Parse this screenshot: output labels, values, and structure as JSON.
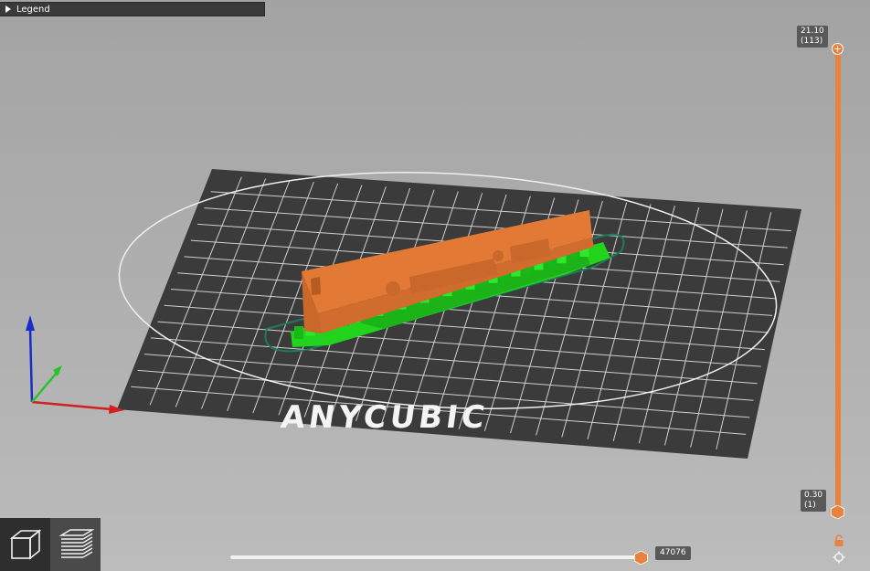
{
  "legend": {
    "label": "Legend"
  },
  "bed": {
    "brand_text": "ANYCUBIC"
  },
  "layer_slider": {
    "top_value": "21.10",
    "top_layer": "(113)",
    "bottom_value": "0.30",
    "bottom_layer": "(1)"
  },
  "move_slider": {
    "value": "47076"
  },
  "colors": {
    "accent": "#e8823f",
    "model": "#e8823f",
    "support": "#22d31e",
    "bed": "#3b3b3b",
    "skirt": "#1d7a5c"
  },
  "icons": [
    "legend-expand-icon",
    "3d-view-icon",
    "preview-layers-icon",
    "lock-icon",
    "settings-cog-icon",
    "plus-icon"
  ]
}
